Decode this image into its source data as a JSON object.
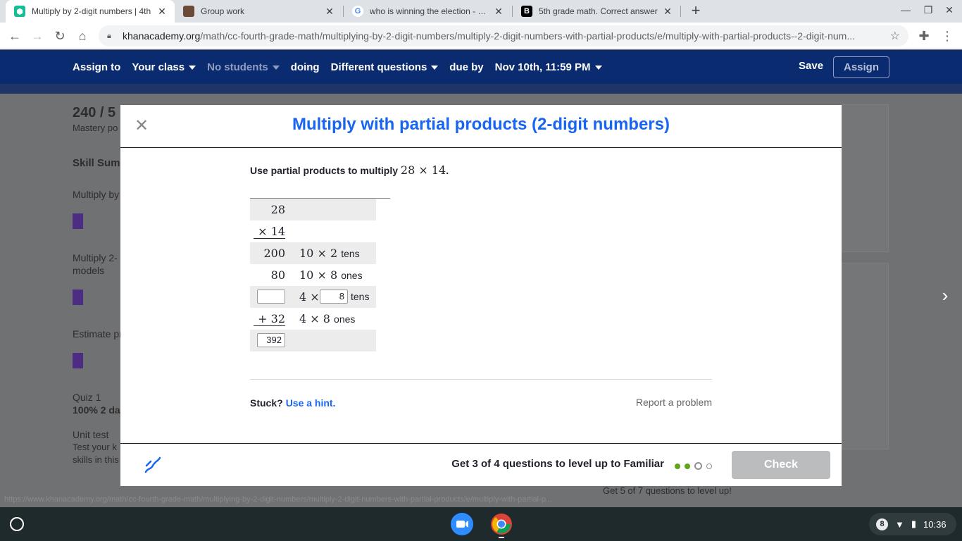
{
  "browser": {
    "tabs": [
      {
        "title": "Multiply by 2-digit numbers | 4th",
        "active": true
      },
      {
        "title": "Group work",
        "active": false
      },
      {
        "title": "who is winning the election - Goo",
        "active": false
      },
      {
        "title": "5th grade math. Correct answer",
        "active": false
      }
    ],
    "url_domain": "khanacademy.org",
    "url_path": "/math/cc-fourth-grade-math/multiplying-by-2-digit-numbers/multiply-2-digit-numbers-with-partial-products/e/multiply-with-partial-products--2-digit-num..."
  },
  "assign_bar": {
    "assign_to": "Assign to",
    "class": "Your class",
    "students": "No students",
    "doing": "doing",
    "questions": "Different questions",
    "due_by": "due by",
    "due_date": "Nov 10th, 11:59 PM",
    "save": "Save",
    "assign": "Assign"
  },
  "background": {
    "score": "240 / 5",
    "mastery": "Mastery po",
    "skill_summary": "Skill Summ",
    "item1": "Multiply by",
    "item2a": "Multiply 2-",
    "item2b": "models",
    "item3": "Estimate pr",
    "quiz": "Quiz 1",
    "quiz_score": "100% 2 da",
    "unit_test": "Unit test",
    "unit_test_desc1": "Test your k",
    "unit_test_desc2": "skills in this",
    "level_up_hint": "Get 5 of 7 questions to level up!"
  },
  "modal": {
    "title": "Multiply with partial products (2-digit numbers)",
    "prompt_text": "Use partial products to multiply",
    "prompt_math": "28 × 14",
    "prompt_end": ".",
    "rows": [
      {
        "num": "28",
        "desc": "",
        "unit": ""
      },
      {
        "num": "× 14",
        "desc": "",
        "unit": ""
      },
      {
        "num": "200",
        "desc": "10 × 2",
        "unit": "tens"
      },
      {
        "num": "80",
        "desc": "10 × 8",
        "unit": "ones"
      },
      {
        "num": "",
        "desc": "4 ×",
        "unit": "tens",
        "input_value": "8"
      },
      {
        "num": "+ 32",
        "desc": "4 × 8",
        "unit": "ones"
      },
      {
        "num": "",
        "answer_value": "392"
      }
    ],
    "stuck": "Stuck?",
    "hint": "Use a hint.",
    "report": "Report a problem",
    "level_up": "Get 3 of 4 questions to level up to Familiar",
    "progress": {
      "done": 2,
      "current": 1,
      "total": 4
    },
    "check": "Check"
  },
  "status_url": "https://www.khanacademy.org/math/cc-fourth-grade-math/multiplying-by-2-digit-numbers/multiply-2-digit-numbers-with-partial-products/e/multiply-with-partial-p...",
  "shelf": {
    "notifications": "8",
    "time": "10:36"
  },
  "colors": {
    "ka_blue": "#1865f2",
    "assign_bar": "#0b2b70",
    "progress_green": "#5ea41d",
    "check_disabled": "#bbbcbe"
  }
}
